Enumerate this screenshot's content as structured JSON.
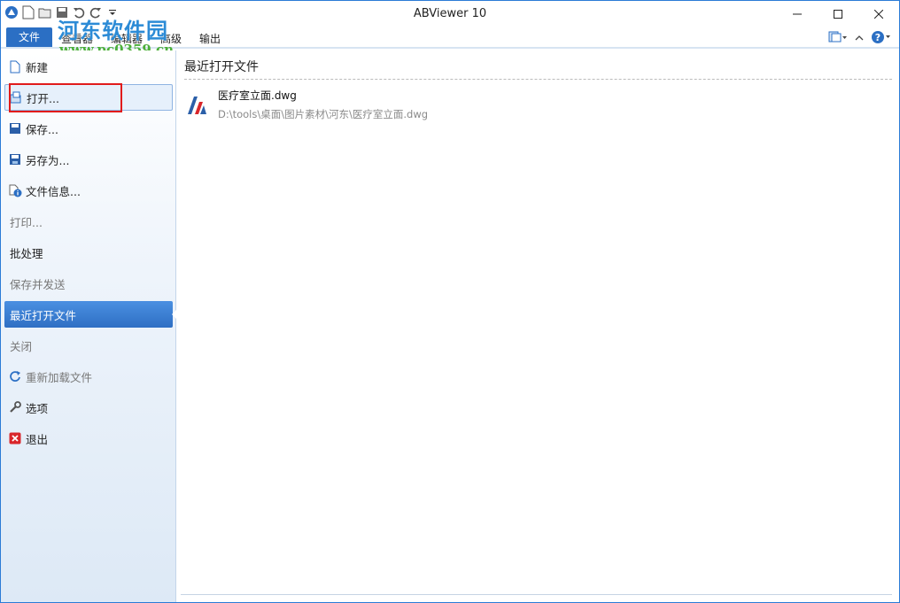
{
  "window": {
    "title": "ABViewer 10"
  },
  "quick_access": {
    "icons": [
      "app-logo-icon",
      "new-doc-icon",
      "open-folder-icon",
      "save-icon",
      "undo-icon",
      "redo-icon",
      "qat-dropdown-icon"
    ]
  },
  "ribbon": {
    "tabs": [
      "文件",
      "查看器",
      "编辑器",
      "高级",
      "输出"
    ]
  },
  "watermark": {
    "text": "河东软件园",
    "url": "www.pc0359.cn"
  },
  "sidebar": {
    "items": [
      {
        "label": "新建",
        "icon": "new-doc-icon"
      },
      {
        "label": "打开...",
        "icon": "open-folder-icon"
      },
      {
        "label": "保存...",
        "icon": "save-icon"
      },
      {
        "label": "另存为...",
        "icon": "save-as-icon"
      },
      {
        "label": "文件信息...",
        "icon": "file-info-icon"
      },
      {
        "label": "打印...",
        "icon": ""
      },
      {
        "label": "批处理",
        "icon": ""
      },
      {
        "label": "保存并发送",
        "icon": ""
      },
      {
        "label": "最近打开文件",
        "icon": ""
      },
      {
        "label": "关闭",
        "icon": ""
      },
      {
        "label": "重新加载文件",
        "icon": "reload-icon"
      },
      {
        "label": "选项",
        "icon": "wrench-icon"
      },
      {
        "label": "退出",
        "icon": "exit-icon"
      }
    ]
  },
  "content": {
    "title": "最近打开文件",
    "recent_files": [
      {
        "name": "医疗室立面.dwg",
        "path": "D:\\tools\\桌面\\图片素材\\河东\\医疗室立面.dwg"
      }
    ]
  },
  "colors": {
    "accent": "#2b6fc4",
    "highlight_box": "#e11b1b",
    "watermark_blue": "#2c8bd6",
    "watermark_green": "#4caf3a"
  }
}
